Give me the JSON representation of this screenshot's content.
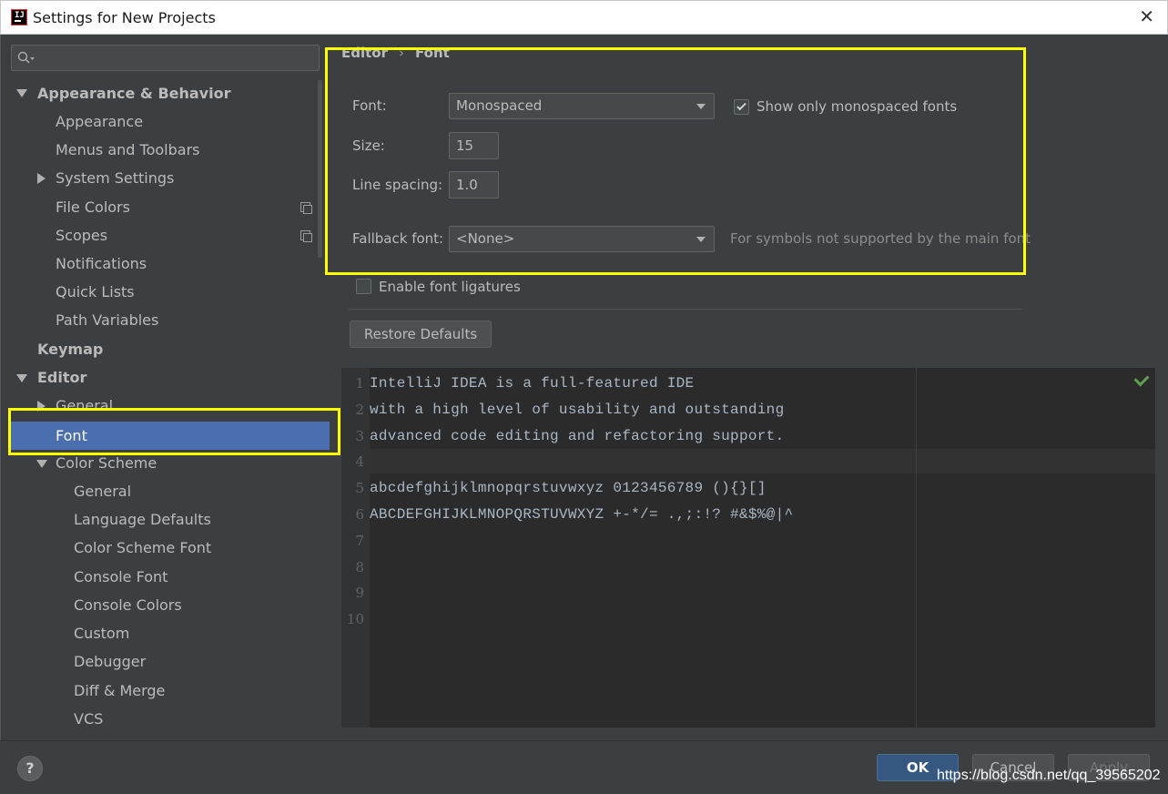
{
  "window": {
    "title": "Settings for New Projects",
    "close_glyph": "✕"
  },
  "search": {
    "placeholder": "",
    "value": ""
  },
  "sidebar": {
    "items": [
      {
        "label": "Appearance & Behavior"
      },
      {
        "label": "Appearance"
      },
      {
        "label": "Menus and Toolbars"
      },
      {
        "label": "System Settings"
      },
      {
        "label": "File Colors"
      },
      {
        "label": "Scopes"
      },
      {
        "label": "Notifications"
      },
      {
        "label": "Quick Lists"
      },
      {
        "label": "Path Variables"
      },
      {
        "label": "Keymap"
      },
      {
        "label": "Editor"
      },
      {
        "label": "General"
      },
      {
        "label": "Font"
      },
      {
        "label": "Color Scheme"
      },
      {
        "label": "General"
      },
      {
        "label": "Language Defaults"
      },
      {
        "label": "Color Scheme Font"
      },
      {
        "label": "Console Font"
      },
      {
        "label": "Console Colors"
      },
      {
        "label": "Custom"
      },
      {
        "label": "Debugger"
      },
      {
        "label": "Diff & Merge"
      },
      {
        "label": "VCS"
      }
    ],
    "selected": "Font"
  },
  "breadcrumb": {
    "parent": "Editor",
    "separator": "›",
    "current": "Font"
  },
  "form": {
    "font_label": "Font:",
    "font_value": "Monospaced",
    "mono_only_label": "Show only monospaced fonts",
    "mono_only_checked": true,
    "size_label": "Size:",
    "size_value": "15",
    "line_spacing_label": "Line spacing:",
    "line_spacing_value": "1.0",
    "fallback_label": "Fallback font:",
    "fallback_value": "<None>",
    "fallback_hint": "For symbols not supported by the main font",
    "ligatures_label": "Enable font ligatures",
    "ligatures_checked": false,
    "restore_label": "Restore Defaults"
  },
  "preview": {
    "lines": [
      {
        "num": "1",
        "text": "IntelliJ IDEA is a full-featured IDE"
      },
      {
        "num": "2",
        "text": "with a high level of usability and outstanding"
      },
      {
        "num": "3",
        "text": "advanced code editing and refactoring support."
      },
      {
        "num": "4",
        "text": ""
      },
      {
        "num": "5",
        "text": "abcdefghijklmnopqrstuvwxyz 0123456789 (){}[]"
      },
      {
        "num": "6",
        "text": "ABCDEFGHIJKLMNOPQRSTUVWXYZ +-*/= .,;:!? #&$%@|^"
      },
      {
        "num": "7",
        "text": ""
      },
      {
        "num": "8",
        "text": ""
      },
      {
        "num": "9",
        "text": ""
      },
      {
        "num": "10",
        "text": ""
      }
    ]
  },
  "footer": {
    "help": "?",
    "ok": "OK",
    "cancel": "Cancel",
    "apply": "Apply"
  },
  "watermark": "https://blog.csdn.net/qq_39565202",
  "colors": {
    "accent": "#4b6eaf",
    "highlight": "#ffff00",
    "background": "#3c3f41",
    "editor_bg": "#2b2b2b"
  }
}
